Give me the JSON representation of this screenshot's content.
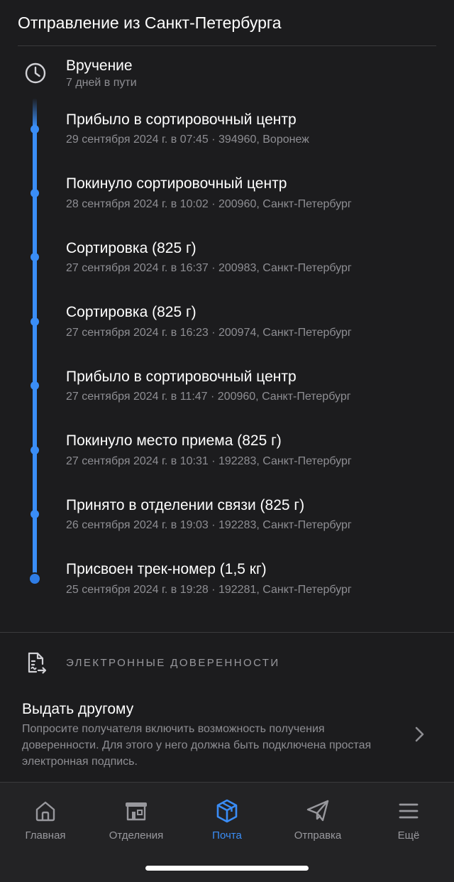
{
  "header": {
    "title": "Отправление из Санкт-Петербурга"
  },
  "delivery": {
    "status": "Вручение",
    "days_in_transit": "7 дней в пути"
  },
  "events": [
    {
      "title": "Прибыло в сортировочный центр",
      "meta": "29 сентября 2024 г. в 07:45 · 394960, Воронеж"
    },
    {
      "title": "Покинуло сортировочный центр",
      "meta": "28 сентября 2024 г. в 10:02 · 200960, Санкт-Петербург"
    },
    {
      "title": "Сортировка  (825 г)",
      "meta": "27 сентября 2024 г. в 16:37 · 200983, Санкт-Петербург"
    },
    {
      "title": "Сортировка  (825 г)",
      "meta": "27 сентября 2024 г. в 16:23 · 200974, Санкт-Петербург"
    },
    {
      "title": "Прибыло в сортировочный центр",
      "meta": "27 сентября 2024 г. в 11:47 · 200960, Санкт-Петербург"
    },
    {
      "title": "Покинуло место приема  (825 г)",
      "meta": "27 сентября 2024 г. в 10:31 · 192283, Санкт-Петербург"
    },
    {
      "title": "Принято в отделении связи  (825 г)",
      "meta": "26 сентября 2024 г. в 19:03 · 192283, Санкт-Петербург"
    },
    {
      "title": "Присвоен трек-номер  (1,5 кг)",
      "meta": "25 сентября 2024 г. в 19:28 · 192281, Санкт-Петербург"
    }
  ],
  "proxies": {
    "heading": "ЭЛЕКТРОННЫЕ ДОВЕРЕННОСТИ",
    "delegate_title": "Выдать другому",
    "delegate_desc": "Попросите получателя включить возможность получения доверенности. Для этого у него должна быть подключена простая электронная подпись."
  },
  "tabbar": {
    "items": [
      {
        "label": "Главная",
        "icon": "home-icon"
      },
      {
        "label": "Отделения",
        "icon": "store-icon"
      },
      {
        "label": "Почта",
        "icon": "parcel-icon"
      },
      {
        "label": "Отправка",
        "icon": "send-icon"
      },
      {
        "label": "Ещё",
        "icon": "menu-icon"
      }
    ],
    "active_index": 2,
    "active_color": "#3a8df6",
    "inactive_color": "#98989d"
  },
  "colors": {
    "background": "#1c1c1e",
    "accent": "#3a8df6",
    "secondary_text": "#8e8e93"
  }
}
